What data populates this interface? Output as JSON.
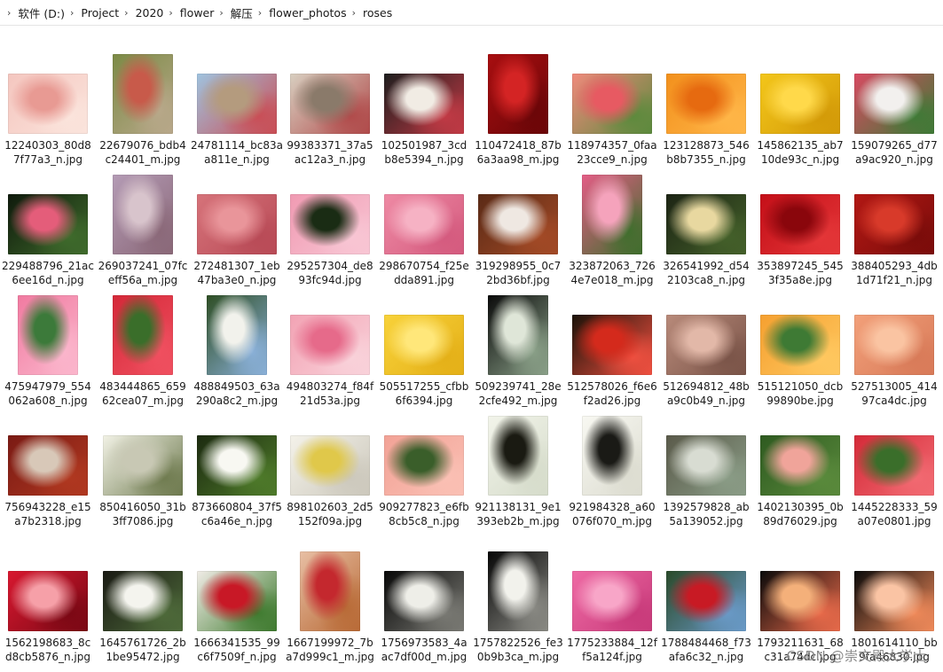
{
  "breadcrumb": {
    "items": [
      "软件 (D:)",
      "Project",
      "2020",
      "flower",
      "解压",
      "flower_photos",
      "roses"
    ]
  },
  "files": [
    {
      "name": "12240303_80d87f77a3_n.jpg",
      "orient": "landscape",
      "colors": [
        "#f4c6bf",
        "#e89a93",
        "#fbe4dc"
      ]
    },
    {
      "name": "22679076_bdb4c24401_m.jpg",
      "orient": "portrait",
      "colors": [
        "#7b8a45",
        "#c85a4a",
        "#b8a88a"
      ]
    },
    {
      "name": "24781114_bc83aa811e_n.jpg",
      "orient": "landscape",
      "colors": [
        "#9fc3df",
        "#b49b7e",
        "#c94d55"
      ]
    },
    {
      "name": "99383371_37a5ac12a3_n.jpg",
      "orient": "landscape",
      "colors": [
        "#d8cfc0",
        "#8a7a6a",
        "#b04a4a"
      ]
    },
    {
      "name": "102501987_3cdb8e5394_n.jpg",
      "orient": "landscape",
      "colors": [
        "#1e1e1e",
        "#f1ece4",
        "#c23a45"
      ]
    },
    {
      "name": "110472418_87b6a3aa98_m.jpg",
      "orient": "portrait",
      "colors": [
        "#a80e10",
        "#d42424",
        "#6a0608"
      ]
    },
    {
      "name": "118974357_0faa23cce9_n.jpg",
      "orient": "landscape",
      "colors": [
        "#f08a7c",
        "#e75a62",
        "#5b8a3c"
      ]
    },
    {
      "name": "123128873_546b8b7355_n.jpg",
      "orient": "landscape",
      "colors": [
        "#f2901c",
        "#e66a10",
        "#ffb648"
      ]
    },
    {
      "name": "145862135_ab710de93c_n.jpg",
      "orient": "landscape",
      "colors": [
        "#f3c61a",
        "#ffd94a",
        "#d39a08"
      ]
    },
    {
      "name": "159079265_d77a9ac920_n.jpg",
      "orient": "landscape",
      "colors": [
        "#d84a62",
        "#f2f0ee",
        "#3e7a36"
      ]
    },
    {
      "name": "229488796_21ac6ee16d_n.jpg",
      "orient": "landscape",
      "colors": [
        "#0f1a0c",
        "#e45d7a",
        "#3f6b2c"
      ]
    },
    {
      "name": "269037241_07fceff56a_m.jpg",
      "orient": "portrait",
      "colors": [
        "#b49bb5",
        "#d8c4cc",
        "#8a6878"
      ]
    },
    {
      "name": "272481307_1eb47ba3e0_n.jpg",
      "orient": "landscape",
      "colors": [
        "#d6737a",
        "#e9959a",
        "#b84a56"
      ]
    },
    {
      "name": "295257304_de893fc94d.jpg",
      "orient": "landscape",
      "colors": [
        "#f09ab2",
        "#1a2c14",
        "#f8c6d4"
      ]
    },
    {
      "name": "298670754_f25edda891.jpg",
      "orient": "landscape",
      "colors": [
        "#ee8aa4",
        "#f6b2c4",
        "#d45a7e"
      ]
    },
    {
      "name": "319298955_0c72bd36bf.jpg",
      "orient": "landscape",
      "colors": [
        "#5a2a16",
        "#efe8e2",
        "#a34a26"
      ]
    },
    {
      "name": "323872063_7264e7e018_m.jpg",
      "orient": "portrait",
      "colors": [
        "#e45d86",
        "#f5a3bc",
        "#3e6e2c"
      ]
    },
    {
      "name": "326541992_d542103ca8_n.jpg",
      "orient": "landscape",
      "colors": [
        "#1c2414",
        "#e8d8a0",
        "#44602a"
      ]
    },
    {
      "name": "353897245_5453f35a8e.jpg",
      "orient": "landscape",
      "colors": [
        "#c40f18",
        "#8a060c",
        "#e43638"
      ]
    },
    {
      "name": "388405293_4db1d71f21_n.jpg",
      "orient": "landscape",
      "colors": [
        "#b21814",
        "#d83a2a",
        "#7a0c0a"
      ]
    },
    {
      "name": "475947979_554062a608_n.jpg",
      "orient": "portrait",
      "colors": [
        "#f07aa0",
        "#3c7a3a",
        "#fbb6cc"
      ]
    },
    {
      "name": "483444865_65962cea07_m.jpg",
      "orient": "portrait",
      "colors": [
        "#d42838",
        "#3a6e2a",
        "#f05060"
      ]
    },
    {
      "name": "488849503_63a290a8c2_m.jpg",
      "orient": "portrait",
      "colors": [
        "#2e4e24",
        "#f2f2ec",
        "#8ab0d8"
      ]
    },
    {
      "name": "494803274_f84f21d53a.jpg",
      "orient": "landscape",
      "colors": [
        "#f2a3b4",
        "#e66a8a",
        "#f9d2da"
      ]
    },
    {
      "name": "505517255_cfbb6f6394.jpg",
      "orient": "landscape",
      "colors": [
        "#f8d23a",
        "#ffe77a",
        "#e4b018"
      ]
    },
    {
      "name": "509239741_28e2cfe492_m.jpg",
      "orient": "portrait",
      "colors": [
        "#0a0a0a",
        "#dfe6d8",
        "#8aa088"
      ]
    },
    {
      "name": "512578026_f6e6f2ad26.jpg",
      "orient": "landscape",
      "colors": [
        "#1a1208",
        "#d42a1c",
        "#f05040"
      ]
    },
    {
      "name": "512694812_48ba9c0b49_n.jpg",
      "orient": "landscape",
      "colors": [
        "#b88a7a",
        "#e2b8a8",
        "#7a5448"
      ]
    },
    {
      "name": "515121050_dcb99890be.jpg",
      "orient": "landscape",
      "colors": [
        "#f5a030",
        "#3e7a34",
        "#ffc860"
      ]
    },
    {
      "name": "527513005_41497ca4dc.jpg",
      "orient": "landscape",
      "colors": [
        "#f2a07a",
        "#fac4a2",
        "#d87a58"
      ]
    },
    {
      "name": "756943228_e15a7b2318.jpg",
      "orient": "landscape",
      "colors": [
        "#7a1a14",
        "#d8c8b8",
        "#b03820"
      ]
    },
    {
      "name": "850416050_31b3ff7086.jpg",
      "orient": "landscape",
      "colors": [
        "#f2f2e6",
        "#c8c8b4",
        "#6e7a4e"
      ]
    },
    {
      "name": "873660804_37f5c6a46e_n.jpg",
      "orient": "landscape",
      "colors": [
        "#1c2a10",
        "#f8f8f2",
        "#4e7a2a"
      ]
    },
    {
      "name": "898102603_2d5152f09a.jpg",
      "orient": "landscape",
      "colors": [
        "#f4f2ea",
        "#e0c84a",
        "#ccc8bc"
      ]
    },
    {
      "name": "909277823_e6fb8cb5c8_n.jpg",
      "orient": "landscape",
      "colors": [
        "#f2a296",
        "#3a5e2a",
        "#fac0b4"
      ]
    },
    {
      "name": "921138131_9e1393eb2b_m.jpg",
      "orient": "portrait",
      "colors": [
        "#f2f4ea",
        "#1a1a12",
        "#d6dccb"
      ]
    },
    {
      "name": "921984328_a60076f070_m.jpg",
      "orient": "portrait",
      "colors": [
        "#f8f8f2",
        "#1a1a16",
        "#dcdcd0"
      ]
    },
    {
      "name": "1392579828_ab5a139052.jpg",
      "orient": "landscape",
      "colors": [
        "#5a5a4a",
        "#d8dcd2",
        "#8a9c86"
      ]
    },
    {
      "name": "1402130395_0b89d76029.jpg",
      "orient": "landscape",
      "colors": [
        "#2e5a20",
        "#f0a49a",
        "#5a8a3c"
      ]
    },
    {
      "name": "1445228333_59a07e0801.jpg",
      "orient": "landscape",
      "colors": [
        "#d42a38",
        "#3a6e2a",
        "#f26a72"
      ]
    },
    {
      "name": "1562198683_8cd8cb5876_n.jpg",
      "orient": "landscape",
      "colors": [
        "#d81830",
        "#f6a0a8",
        "#7a0814"
      ]
    },
    {
      "name": "1645761726_2b1be95472.jpg",
      "orient": "landscape",
      "colors": [
        "#1a1a14",
        "#f4f4ee",
        "#4e6a3a"
      ]
    },
    {
      "name": "1666341535_99c6f7509f_n.jpg",
      "orient": "landscape",
      "colors": [
        "#f0ece6",
        "#c81826",
        "#3e7a2e"
      ]
    },
    {
      "name": "1667199972_7ba7d999c1_m.jpg",
      "orient": "portrait",
      "colors": [
        "#e8bfa4",
        "#c4282e",
        "#b86a36"
      ]
    },
    {
      "name": "1756973583_4aac7df00d_m.jpg",
      "orient": "landscape",
      "colors": [
        "#080808",
        "#eeeee8",
        "#7a7a74"
      ]
    },
    {
      "name": "1757822526_fe30b9b3ca_m.jpg",
      "orient": "portrait",
      "colors": [
        "#060606",
        "#f2f2ec",
        "#8a8a84"
      ]
    },
    {
      "name": "1775233884_12ff5a124f.jpg",
      "orient": "landscape",
      "colors": [
        "#ee6aa4",
        "#f8a6c8",
        "#c83a7a"
      ]
    },
    {
      "name": "1788484468_f73afa6c32_n.jpg",
      "orient": "landscape",
      "colors": [
        "#2a4a2a",
        "#c81a24",
        "#6a9ac8"
      ]
    },
    {
      "name": "1793211631_68c31a74dc.jpg",
      "orient": "landscape",
      "colors": [
        "#0a0a0a",
        "#f4b07a",
        "#e86a4a"
      ]
    },
    {
      "name": "1801614110_bb9fa46830.jpg",
      "orient": "landscape",
      "colors": [
        "#0a0a0a",
        "#fac4a4",
        "#f08a5a"
      ]
    }
  ],
  "watermark": "CSDN @崇文殿大学士"
}
